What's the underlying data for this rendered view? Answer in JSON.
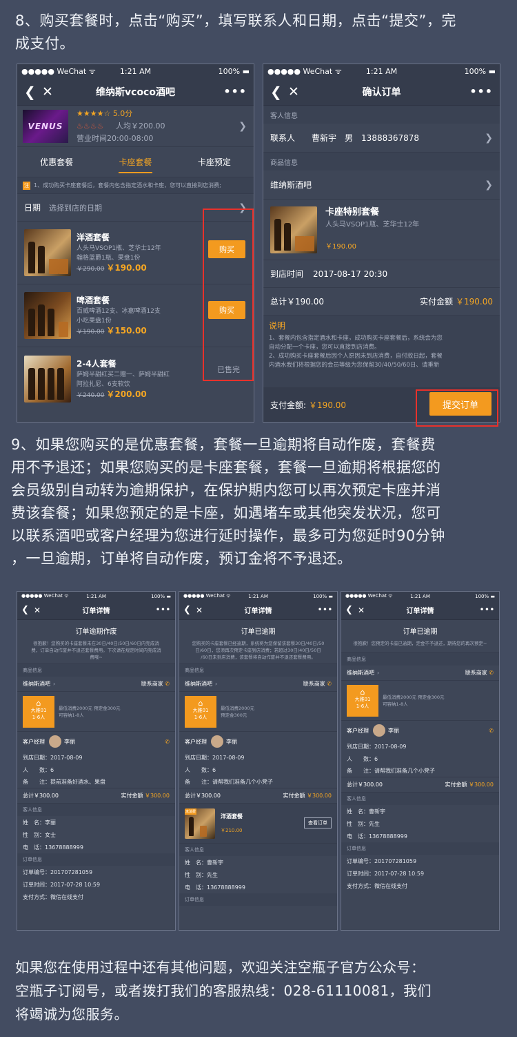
{
  "step8_text": [
    "8、购买套餐时，点击“购买”，填写联系人和日期，点击“提交”，完",
    "成支付。"
  ],
  "step9_text": [
    "9、如果您购买的是优惠套餐，套餐一旦逾期将自动作废，套餐费",
    "用不予退还；如果您购买的是卡座套餐，套餐一旦逾期将根据您的",
    "会员级别自动转为逾期保护，在保护期内您可以再次预定卡座并消",
    "费该套餐；如果您预定的是卡座，如遇堵车或其他突发状况，您可",
    "以联系酒吧或客户经理为您进行延时操作，最多可为您延时90分钟",
    "，一旦逾期，订单将自动作废，预订金将不予退还。"
  ],
  "footer_text": [
    "如果您在使用过程中还有其他问题，欢迎关注空瓶子官方公众号：",
    "空瓶子订阅号，或者拨打我们的客服热线：028-61110081，我们",
    "将竭诚为您服务。"
  ],
  "status": {
    "carrier": "●●●●● WeChat ᯤ",
    "time": "1:21 AM",
    "battery": "100% ▬"
  },
  "phone1": {
    "title": "维纳斯vcoco酒吧",
    "logo_text": "VENUS",
    "rating": "5.0分",
    "avg": "人均￥200.00",
    "hours": "营业时间20:00-08:00",
    "tabs": [
      "优惠套餐",
      "卡座套餐",
      "卡座预定"
    ],
    "notice_icon": "注",
    "notice": "1、成功购买卡座套餐后，套餐内包含指定酒水和卡座，您可以直接到店消费;",
    "date_label": "日期",
    "date_placeholder": "选择到店的日期",
    "packages": [
      {
        "name": "洋酒套餐",
        "desc1": "人头马VSOP1瓶、芝华士12年",
        "desc2": "翰格蓝爵1瓶、果盘1份",
        "old": "￥290.00",
        "price": "￥190.00",
        "action": "购买"
      },
      {
        "name": "啤酒套餐",
        "desc1": "百威啤酒12支、冰嘉啤酒12支",
        "desc2": "小吃果盘1份",
        "old": "￥190.00",
        "price": "￥150.00",
        "action": "购买"
      },
      {
        "name": "2-4人套餐",
        "desc1": "萨姆半甜红买二赠一、萨姆半甜红",
        "desc2": "阿拉扎尼、6支软饮",
        "old": "￥240.00",
        "price": "￥200.00",
        "action": "已售完"
      }
    ]
  },
  "phone2": {
    "title": "确认订单",
    "customer_section": "客人信息",
    "contact_label": "联系人",
    "contact": "曹新宇",
    "gender": "男",
    "phone": "13888367878",
    "product_section": "商品信息",
    "bar": "维纳斯酒吧",
    "pkg_name": "卡座特别套餐",
    "pkg_desc": "人头马VSOP1瓶、芝华士12年",
    "pkg_price": "￥190.00",
    "arrive_label": "到店时间",
    "arrive": "2017-08-17 20:30",
    "total": "总计￥190.00",
    "paid_label": "实付金额",
    "paid": "￥190.00",
    "note_title": "说明",
    "note_lines": [
      "1、套餐内包含指定酒水和卡座，成功购买卡座套餐后，系统会为您",
      "自动分配一个卡座，您可以直接到店消费。",
      "2、成功购买卡座套餐后因个人原因未到店消费，自付款日起，套餐",
      "内酒水我们将根据您的会员等级为您保留30/40/50/60日、请重新"
    ],
    "pay_label": "支付金额:",
    "pay": "￥190.00",
    "submit": "提交订单"
  },
  "phones_small": [
    {
      "title": "订单详情",
      "state": "订单逾期作废",
      "state_desc": [
        "很抱歉！您购买的卡座套餐未在30日/40日/50日/60日内完成消",
        "费，订单自动作废并不退还套餐费用。下次请在规定时间内完成消",
        "费哦~"
      ],
      "product_section": "商品信息",
      "bar": "维纳斯酒吧",
      "contact_shop": "联系商家",
      "seat": "大雅01",
      "seat_size": "1-6人",
      "min_spend": "最低消费2000元 预定金300元",
      "capacity": "可容纳1-8人",
      "manager_label": "客户经理",
      "manager": "李丽",
      "date": "到店日期：2017-08-09",
      "people": "人　　数：6",
      "note": "备　　注：提前准备好酒水、果盘",
      "total": "总计￥300.00",
      "paid_label": "实付金额",
      "paid": "￥300.00",
      "guest_section": "客人信息",
      "guest": [
        "姓　名：李丽",
        "性　别：女士",
        "电　话：13678888999"
      ],
      "order_section": "订单信息",
      "order": [
        "订单编号：201707281059",
        "订单时间：2017-07-28  10:59",
        "支付方式：微信在线支付"
      ]
    },
    {
      "title": "订单详情",
      "state": "订单已逾期",
      "state_desc": [
        "您购买的卡座套餐已经逾期，系统将为您保留该套餐30日/40日/50",
        "日/60日，您须再次预定卡座到店消费；若超过30日/40日/50日",
        "/60日未到店消费，该套餐将自动作废并不退还套餐费用。"
      ],
      "product_section": "商品信息",
      "bar": "维纳斯酒吧",
      "contact_shop": "联系商家",
      "seat": "大雅01",
      "seat_size": "1-6人",
      "min_spend": "最低消费2000元",
      "capacity": "预定金300元",
      "manager_label": "客户经理",
      "manager": "李丽",
      "date": "到店日期：2017-08-09",
      "people": "人　　数：6",
      "note": "备　　注：请帮我们准备几个小凳子",
      "total": "总计￥300.00",
      "paid_label": "实付金额",
      "paid": "￥300.00",
      "pkg_tag": "未消费",
      "pkg_name": "洋酒套餐",
      "pkg_price": "￥210.00",
      "pkg_btn": "查看订单",
      "guest_section": "客人信息",
      "guest": [
        "姓　名：曹新宇",
        "性　别：先生",
        "电　话：13678888999"
      ],
      "order_section": "订单信息"
    },
    {
      "title": "订单详情",
      "state": "订单已逾期",
      "state_desc": [
        "很抱歉！您预定的卡座已逾期，定金不予退还，期待您的再次预定~"
      ],
      "product_section": "商品信息",
      "bar": "维纳斯酒吧",
      "contact_shop": "联系商家",
      "seat": "大雅01",
      "seat_size": "1-6人",
      "min_spend": "最低消费2000元 预定金300元",
      "capacity": "可容纳1-8人",
      "manager_label": "客户经理",
      "manager": "李丽",
      "date": "到店日期：2017-08-09",
      "people": "人　　数：6",
      "note": "备　　注：请帮我们准备几个小凳子",
      "total": "总计￥300.00",
      "paid_label": "实付金额",
      "paid": "￥300.00",
      "guest_section": "客人信息",
      "guest": [
        "姓　名：曹新宇",
        "性　别：先生",
        "电　话：13678888999"
      ],
      "order_section": "订单信息",
      "order": [
        "订单编号：201707281059",
        "订单时间：2017-07-28  10:59",
        "支付方式：微信在线支付"
      ]
    }
  ],
  "colors": {
    "background": "#434c61",
    "accent": "#f39a1f",
    "highlight": "#e8312b"
  }
}
